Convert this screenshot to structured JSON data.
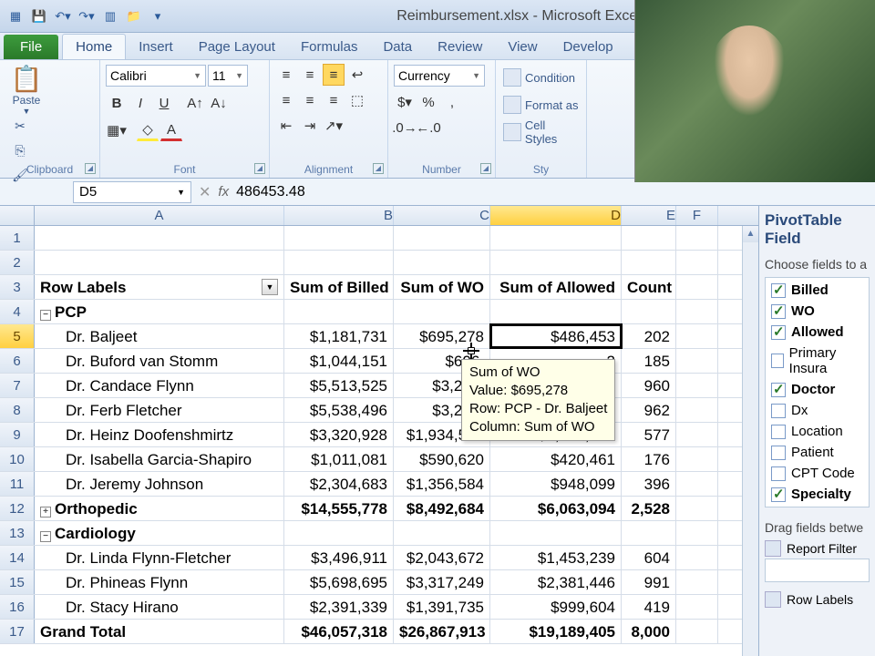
{
  "titlebar": {
    "title": "Reimbursement.xlsx - Microsoft Excel"
  },
  "tabs": {
    "file": "File",
    "home": "Home",
    "insert": "Insert",
    "layout": "Page Layout",
    "formulas": "Formulas",
    "data": "Data",
    "review": "Review",
    "view": "View",
    "developer": "Develop"
  },
  "ribbon": {
    "clipboard": {
      "label": "Clipboard",
      "paste": "Paste"
    },
    "font": {
      "label": "Font",
      "name": "Calibri",
      "size": "11"
    },
    "alignment": {
      "label": "Alignment"
    },
    "number": {
      "label": "Number",
      "format": "Currency"
    },
    "styles": {
      "label": "Sty",
      "cond": "Condition",
      "fmt": "Format as",
      "cell": "Cell Styles"
    }
  },
  "namebox": "D5",
  "formula": "486453.48",
  "columns": [
    "A",
    "B",
    "C",
    "D",
    "E",
    "F"
  ],
  "col_widths": {
    "A": 274,
    "B": 120,
    "C": 106,
    "D": 144,
    "E": 60,
    "F": 46
  },
  "fieldlist": {
    "title": "PivotTable Field",
    "sub": "Choose fields to a",
    "items": [
      {
        "label": "Billed",
        "checked": true,
        "bold": true
      },
      {
        "label": "WO",
        "checked": true,
        "bold": true
      },
      {
        "label": "Allowed",
        "checked": true,
        "bold": true
      },
      {
        "label": "Primary Insura",
        "checked": false,
        "bold": false
      },
      {
        "label": "Doctor",
        "checked": true,
        "bold": true
      },
      {
        "label": "Dx",
        "checked": false,
        "bold": false
      },
      {
        "label": "Location",
        "checked": false,
        "bold": false
      },
      {
        "label": "Patient",
        "checked": false,
        "bold": false
      },
      {
        "label": "CPT Code",
        "checked": false,
        "bold": false
      },
      {
        "label": "Specialty",
        "checked": true,
        "bold": true
      }
    ],
    "drag": "Drag fields betwe",
    "zone1": "Report Filter",
    "zone2": "Row Labels"
  },
  "tooltip": {
    "l1": "Sum of WO",
    "l2": "Value: $695,278",
    "l3": "Row: PCP - Dr. Baljeet",
    "l4": "Column: Sum of WO"
  },
  "rows": [
    {
      "n": 1,
      "A": "",
      "B": "",
      "C": "",
      "D": "",
      "E": ""
    },
    {
      "n": 2,
      "A": "",
      "B": "",
      "C": "",
      "D": "",
      "E": ""
    },
    {
      "n": 3,
      "hdr": true,
      "A": "Row Labels",
      "B": "Sum of Billed",
      "C": "Sum of WO",
      "D": "Sum of Allowed",
      "E": "Count"
    },
    {
      "n": 4,
      "bold": true,
      "exp": "−",
      "A": "PCP",
      "B": "",
      "C": "",
      "D": "",
      "E": ""
    },
    {
      "n": 5,
      "sel": true,
      "indent": 2,
      "A": "Dr. Baljeet",
      "B": "$1,181,731",
      "C": "$695,278",
      "D": "$486,453",
      "E": "202"
    },
    {
      "n": 6,
      "indent": 2,
      "A": "Dr. Buford van Stomm",
      "B": "$1,044,151",
      "C": "$606,",
      "D": "2",
      "E": "185"
    },
    {
      "n": 7,
      "indent": 2,
      "A": "Dr. Candace Flynn",
      "B": "$5,513,525",
      "C": "$3,210,",
      "D": "",
      "E": "960"
    },
    {
      "n": 8,
      "indent": 2,
      "A": "Dr. Ferb Fletcher",
      "B": "$5,538,496",
      "C": "$3,228,",
      "D": "9",
      "E": "962"
    },
    {
      "n": 9,
      "indent": 2,
      "A": "Dr. Heinz Doofenshmirtz",
      "B": "$3,320,928",
      "C": "$1,934,520",
      "D": "$1,386,408",
      "E": "577"
    },
    {
      "n": 10,
      "indent": 2,
      "A": "Dr. Isabella Garcia-Shapiro",
      "B": "$1,011,081",
      "C": "$590,620",
      "D": "$420,461",
      "E": "176"
    },
    {
      "n": 11,
      "indent": 2,
      "A": "Dr. Jeremy Johnson",
      "B": "$2,304,683",
      "C": "$1,356,584",
      "D": "$948,099",
      "E": "396"
    },
    {
      "n": 12,
      "bold": true,
      "exp": "+",
      "A": "Orthopedic",
      "B": "$14,555,778",
      "C": "$8,492,684",
      "D": "$6,063,094",
      "E": "2,528"
    },
    {
      "n": 13,
      "bold": true,
      "exp": "−",
      "A": "Cardiology",
      "B": "",
      "C": "",
      "D": "",
      "E": ""
    },
    {
      "n": 14,
      "indent": 2,
      "A": "Dr. Linda Flynn-Fletcher",
      "B": "$3,496,911",
      "C": "$2,043,672",
      "D": "$1,453,239",
      "E": "604"
    },
    {
      "n": 15,
      "indent": 2,
      "A": "Dr. Phineas Flynn",
      "B": "$5,698,695",
      "C": "$3,317,249",
      "D": "$2,381,446",
      "E": "991"
    },
    {
      "n": 16,
      "indent": 2,
      "A": "Dr. Stacy Hirano",
      "B": "$2,391,339",
      "C": "$1,391,735",
      "D": "$999,604",
      "E": "419"
    },
    {
      "n": 17,
      "bold": true,
      "A": "Grand Total",
      "B": "$46,057,318",
      "C": "$26,867,913",
      "D": "$19,189,405",
      "E": "8,000"
    }
  ]
}
